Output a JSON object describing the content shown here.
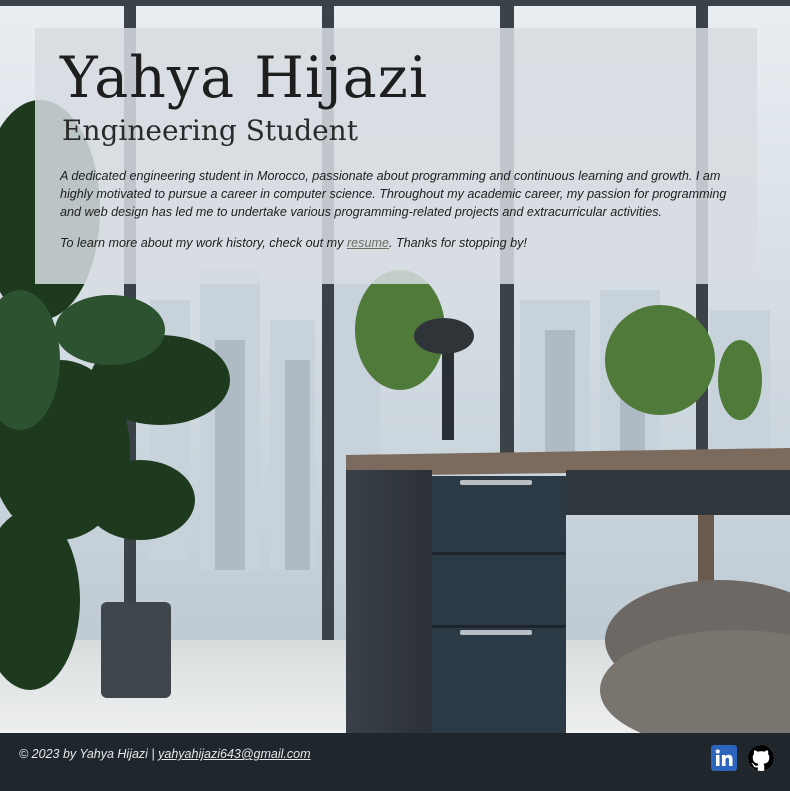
{
  "profile": {
    "name": "Yahya Hijazi",
    "role": "Engineering Student",
    "bio": "A dedicated engineering student in Morocco, passionate about programming and continuous learning and growth. I am highly motivated to pursue a career in computer science. Throughout my academic career, my passion for programming and web design has led me to undertake various programming-related projects and extracurricular activities.",
    "more_before": "To learn more about my work history, check out my ",
    "more_link": "resume",
    "more_after": ". Thanks for stopping by!"
  },
  "footer": {
    "copyright": "© 2023 by Yahya Hijazi | ",
    "email": "yahyahijazi643@gmail.com",
    "social": [
      {
        "icon": "linkedin-icon",
        "color": "#2d64bc"
      },
      {
        "icon": "github-icon",
        "color": "#000000"
      }
    ]
  },
  "colors": {
    "card_overlay": "#d6dce1",
    "footer_bg": "#1f272c",
    "link": "#6a6f62"
  }
}
